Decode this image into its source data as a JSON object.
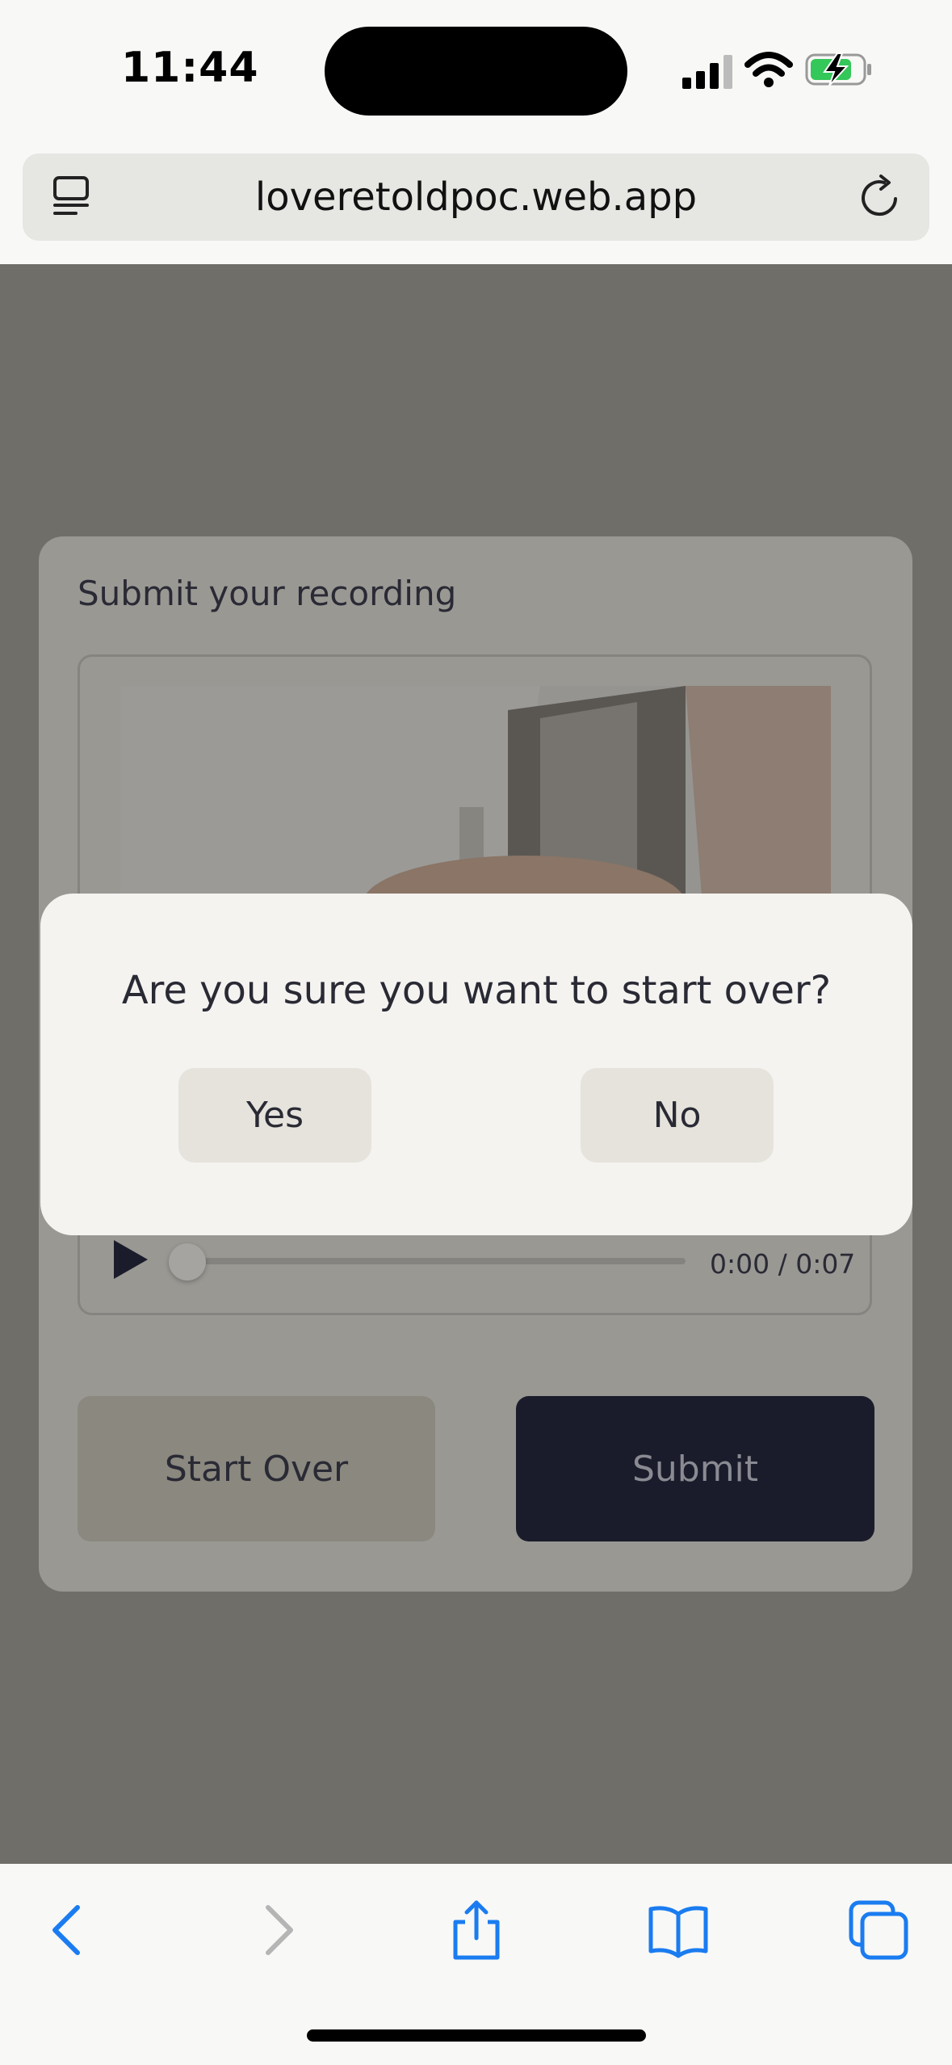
{
  "status_bar": {
    "time": "11:44",
    "icons": [
      "cellular-signal-icon",
      "wifi-icon",
      "battery-charging-icon"
    ],
    "battery_color": "#34c759"
  },
  "browser": {
    "url": "loveretoldpoc.web.app",
    "icons": [
      "tabs-overview-icon",
      "reload-icon"
    ],
    "accent_color": "#1a7cf0"
  },
  "page": {
    "title": "Submit your recording",
    "player": {
      "time_readout": "0:00 / 0:07",
      "progress": 0
    },
    "buttons": {
      "start_over": "Start Over",
      "submit": "Submit"
    }
  },
  "dialog": {
    "question": "Are you sure you want to start over?",
    "yes_label": "Yes",
    "no_label": "No"
  },
  "toolbar": {
    "icons": [
      "back-icon",
      "forward-icon",
      "share-icon",
      "bookmarks-icon",
      "tabs-icon"
    ]
  }
}
